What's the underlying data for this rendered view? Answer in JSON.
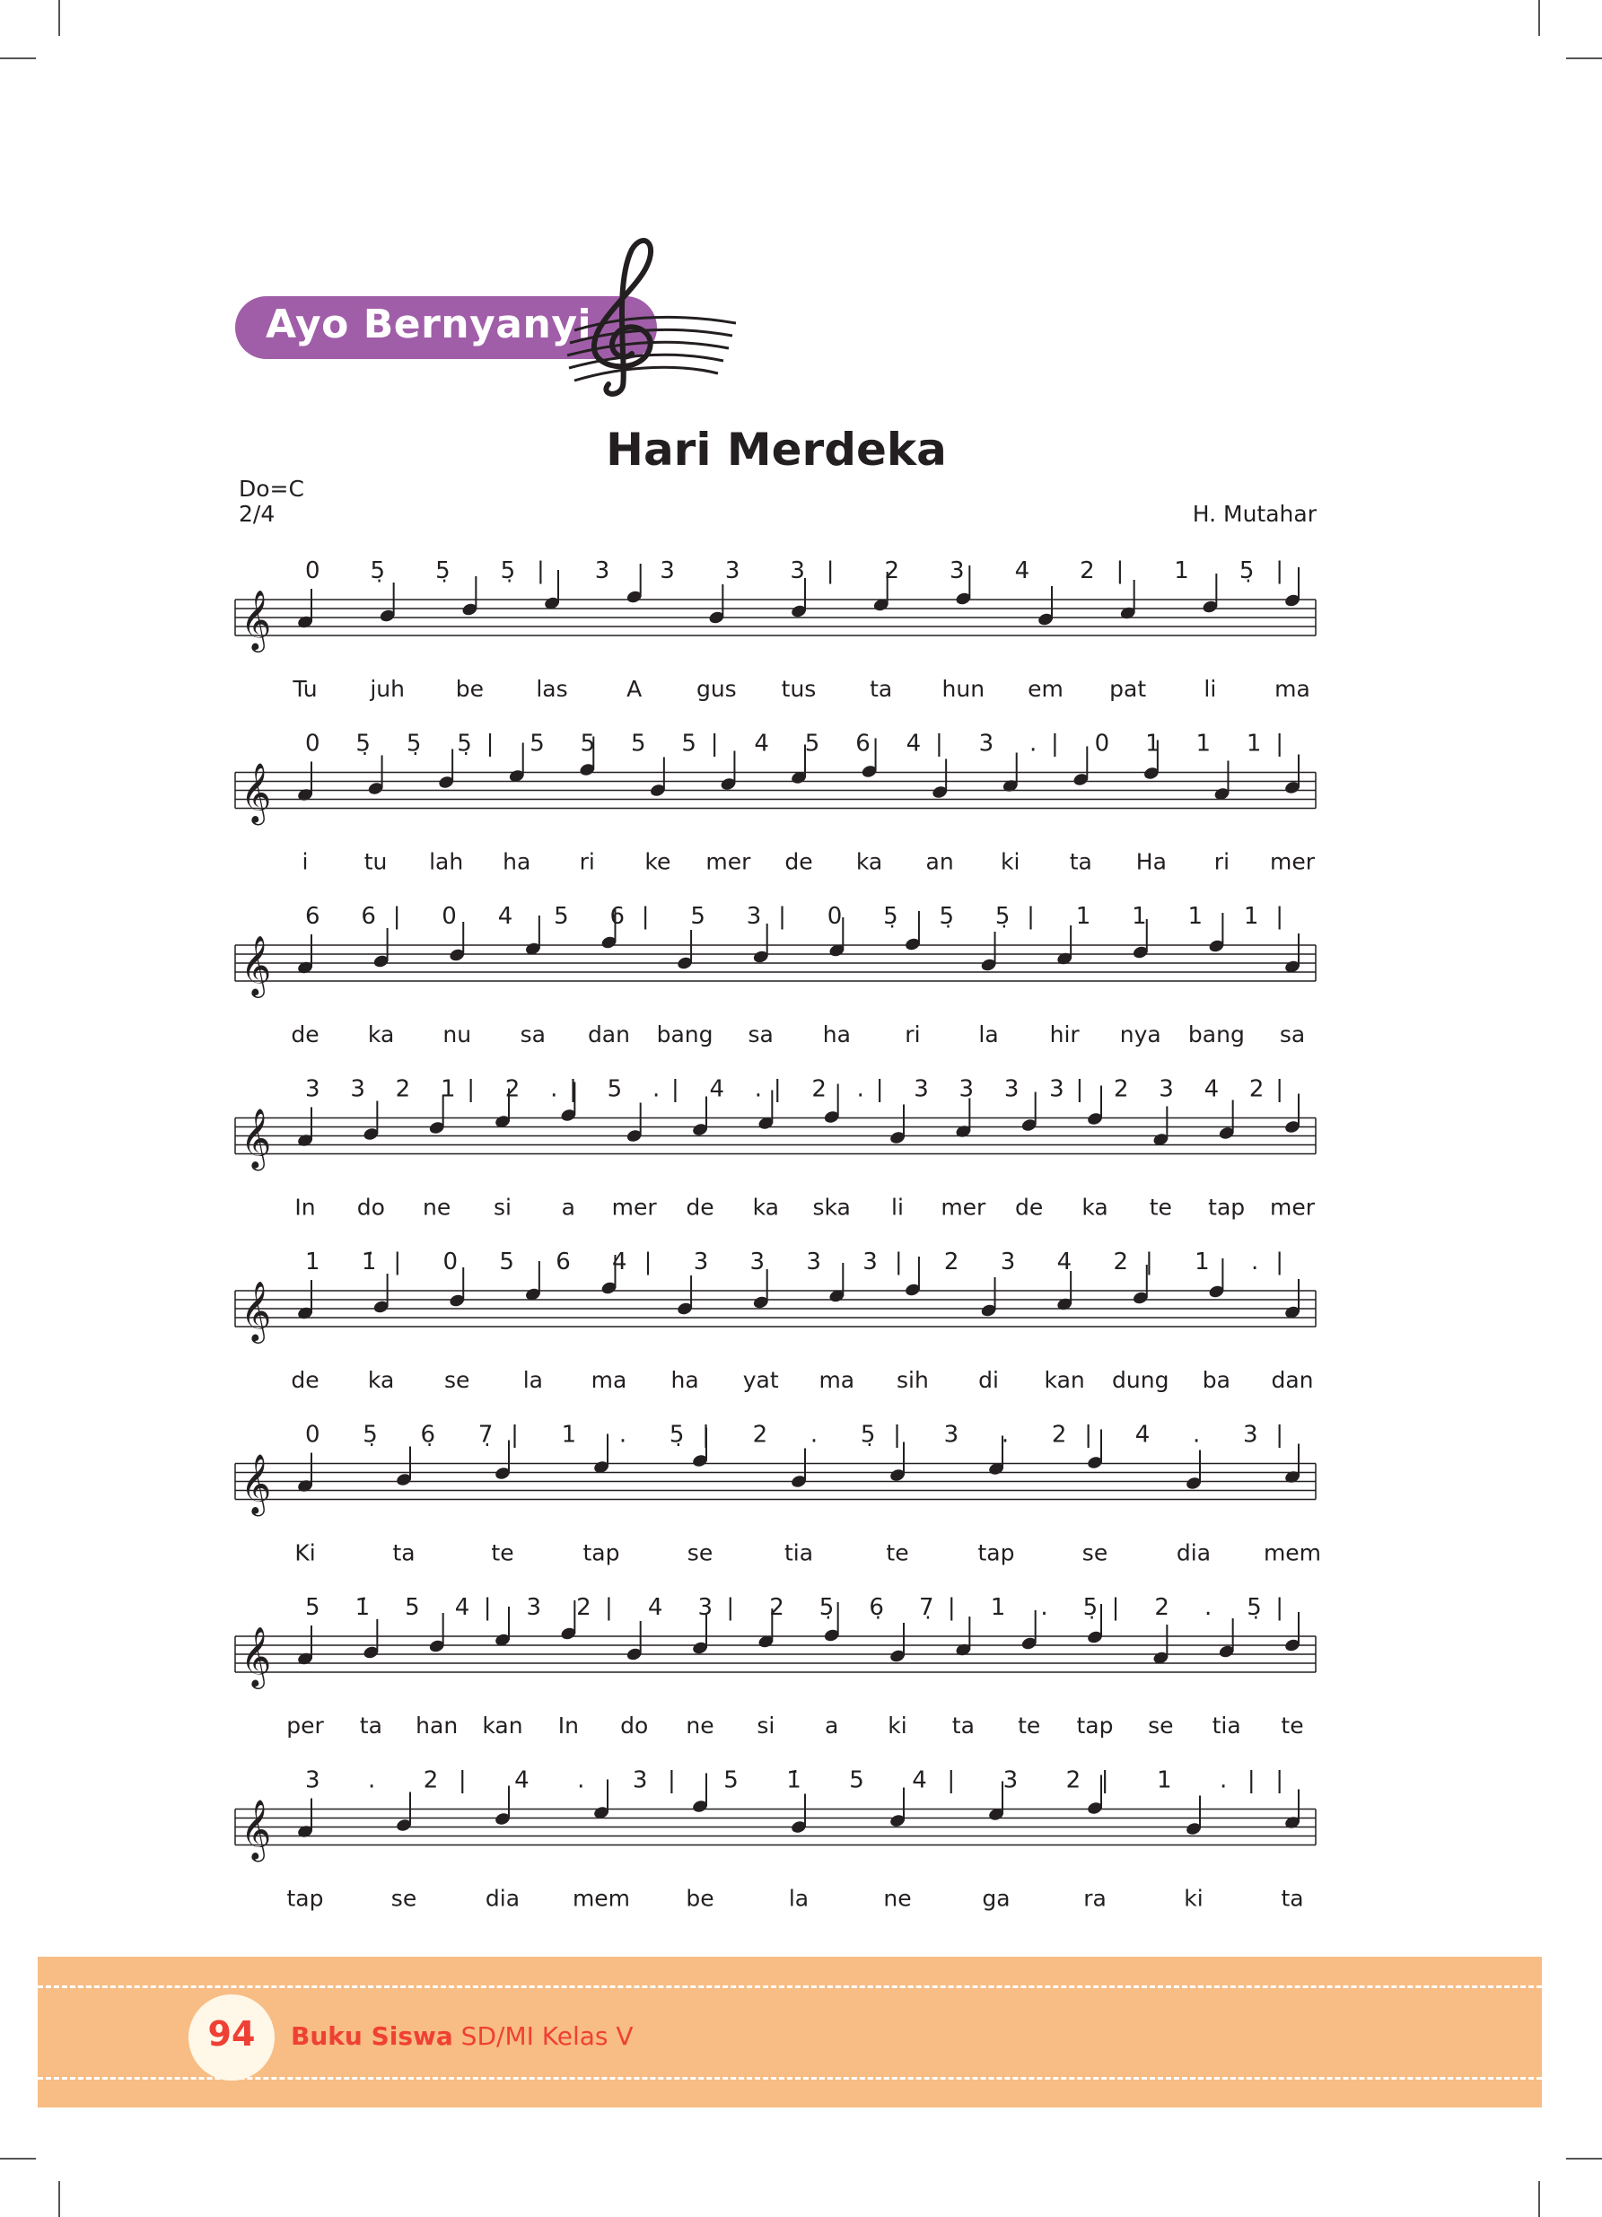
{
  "header": {
    "badge": "Ayo Bernyanyi"
  },
  "song": {
    "title": "Hari Merdeka",
    "key": "Do=C",
    "meter": "2/4",
    "composer": "H. Mutahar"
  },
  "systems": [
    {
      "notation": "0 5̣ 5̣ 5̣| 3 3 3 3| 2 3 4 2| 1 5̣|",
      "lyrics": [
        "Tu",
        "juh",
        "be",
        "las",
        "A",
        "gus",
        "tus",
        "ta",
        "hun",
        "em",
        "pat",
        "li",
        "ma"
      ]
    },
    {
      "notation": "0 5̣ 5̣ 5̣| 5 5 5 5| 4 5 6 4| 3 .| 0 1 1 1|",
      "lyrics": [
        "i",
        "tu",
        "lah",
        "ha",
        "ri",
        "ke",
        "mer",
        "de",
        "ka",
        "an",
        "ki",
        "ta",
        "Ha",
        "ri",
        "mer"
      ]
    },
    {
      "notation": "6 6| 0 4 5 6| 5 3| 0 5̣ 5̣ 5̣| 1 1 1 1|",
      "lyrics": [
        "de",
        "ka",
        "nu",
        "sa",
        "dan",
        "bang",
        "sa",
        "ha",
        "ri",
        "la",
        "hir",
        "nya",
        "bang",
        "sa"
      ]
    },
    {
      "notation": "3 3 2 1| 2 .| 5 .| 4 .| 2 .| 3 3 3 3| 2 3 4 2|",
      "lyrics": [
        "In",
        "do",
        "ne",
        "si",
        "a",
        "mer",
        "de",
        "ka",
        "ska",
        "li",
        "mer",
        "de",
        "ka",
        "te",
        "tap",
        "mer"
      ]
    },
    {
      "notation": "1 1̇| 0 5 6 4| 3 3 3 3| 2 3 4 2| 1 .|",
      "lyrics": [
        "de",
        "ka",
        "se",
        "la",
        "ma",
        "ha",
        "yat",
        "ma",
        "sih",
        "di",
        "kan",
        "dung",
        "ba",
        "dan"
      ]
    },
    {
      "notation": "0 5̣ 6̣ 7̣| 1 . 5̣| 2 . 5̣| 3 . 2| 4 . 3|",
      "lyrics": [
        "Ki",
        "ta",
        "te",
        "tap",
        "se",
        "tia",
        "te",
        "tap",
        "se",
        "dia",
        "mem"
      ]
    },
    {
      "notation": "5 1̇ 5 4| 3 2| 4 3| 2 5̣ 6̣ 7̣| 1 . 5̣| 2 . 5̣|",
      "lyrics": [
        "per",
        "ta",
        "han",
        "kan",
        "In",
        "do",
        "ne",
        "si",
        "a",
        "ki",
        "ta",
        "te",
        "tap",
        "se",
        "tia",
        "te"
      ]
    },
    {
      "notation": "3 . 2| 4 . 3| 5 1̇ 5 4| 3 2| 1 .||",
      "lyrics": [
        "tap",
        "se",
        "dia",
        "mem",
        "be",
        "la",
        "ne",
        "ga",
        "ra",
        "ki",
        "ta"
      ]
    }
  ],
  "footer": {
    "page": "94",
    "book_bold": "Buku Siswa",
    "book_rest": " SD/MI Kelas V"
  },
  "colors": {
    "badge": "#a05ea8",
    "footer_band": "#f8bd84",
    "footer_text": "#ef4035"
  }
}
